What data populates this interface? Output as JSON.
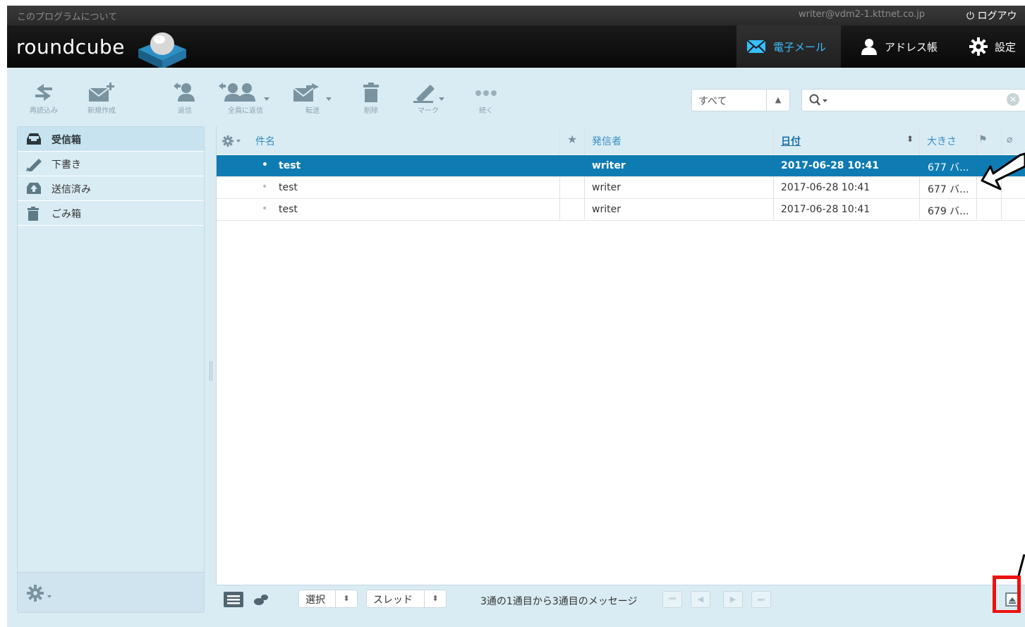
{
  "topline": {
    "about": "このプログラムについて",
    "user": "writer@vdm2-1.kttnet.co.jp",
    "logout": "ログアウト"
  },
  "header": {
    "logo": "roundcube",
    "tabs": {
      "mail": "電子メール",
      "addressbook": "アドレス帳",
      "settings": "設定"
    }
  },
  "toolbar": {
    "refresh": "再読込み",
    "compose": "新規作成",
    "reply": "返信",
    "reply_all": "全員に返信",
    "forward": "転送",
    "delete": "削除",
    "mark": "マーク",
    "more": "続く"
  },
  "filter": {
    "selected": "すべて"
  },
  "search": {
    "value": ""
  },
  "folders": [
    {
      "label": "受信箱",
      "icon": "inbox-icon",
      "selected": true
    },
    {
      "label": "下書き",
      "icon": "pencil-icon",
      "selected": false
    },
    {
      "label": "送信済み",
      "icon": "sent-icon",
      "selected": false
    },
    {
      "label": "ごみ箱",
      "icon": "trash-icon",
      "selected": false
    }
  ],
  "list": {
    "columns": {
      "subject": "件名",
      "from": "発信者",
      "date": "日付",
      "size": "大きさ"
    },
    "rows": [
      {
        "subject": "test",
        "from": "writer",
        "date": "2017-06-28 10:41",
        "size": "677 バ...",
        "selected": true
      },
      {
        "subject": "test",
        "from": "writer",
        "date": "2017-06-28 10:41",
        "size": "677 バ...",
        "selected": false
      },
      {
        "subject": "test",
        "from": "writer",
        "date": "2017-06-28 10:41",
        "size": "679 バ...",
        "selected": false
      }
    ]
  },
  "footer": {
    "select": "選択",
    "threads": "スレッド",
    "count": "3通の1通目から3通目のメッセージ"
  },
  "colors": {
    "accent": "#0f7bb3",
    "nav_active": "#37beff",
    "pane_bg": "#d9ecf4",
    "highlight": "#ee1111"
  }
}
